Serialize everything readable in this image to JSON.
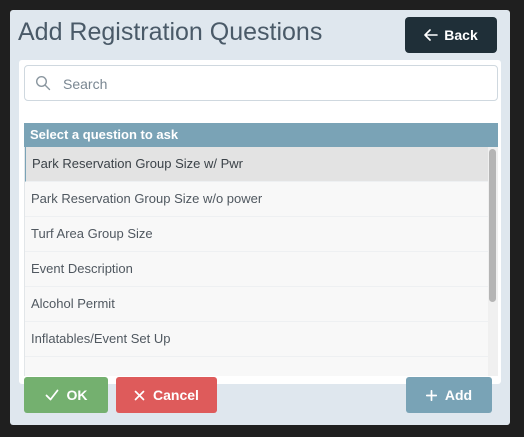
{
  "dialog": {
    "title": "Add Registration Questions",
    "back_label": "Back"
  },
  "search": {
    "placeholder": "Search"
  },
  "list": {
    "header": "Select a question to ask",
    "items": [
      "Park Reservation Group Size w/ Pwr",
      "Park Reservation Group Size w/o power",
      "Turf Area Group Size",
      "Event Description",
      "Alcohol Permit",
      "Inflatables/Event Set Up"
    ]
  },
  "footer": {
    "ok_label": "OK",
    "cancel_label": "Cancel",
    "add_label": "Add"
  },
  "colors": {
    "ok": "#74b06f",
    "cancel": "#de5b5b",
    "add": "#79a3b6",
    "header": "#7aa3b6",
    "back": "#1f2f38"
  }
}
